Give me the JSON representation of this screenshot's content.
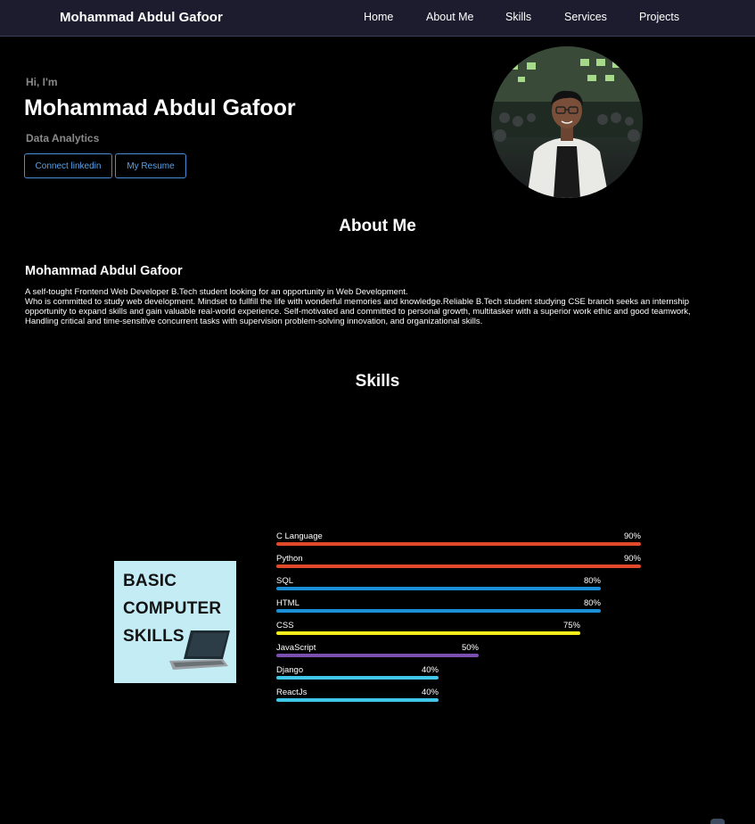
{
  "navbar": {
    "brand": "Mohammad Abdul Gafoor",
    "links": [
      "Home",
      "About Me",
      "Skills",
      "Services",
      "Projects"
    ]
  },
  "hero": {
    "greeting": "Hi, I'm",
    "name": "Mohammad Abdul Gafoor",
    "role": "Data Analytics",
    "buttons": {
      "linkedin": "Connect linkedin",
      "resume": "My Resume"
    }
  },
  "about": {
    "title": "About Me",
    "name": "Mohammad Abdul Gafoor",
    "line1": "A self-tought Frontend Web Developer B.Tech student looking for an opportunity in Web Development.",
    "line2": "Who is committed to study web development. Mindset to fullfill the life with wonderful memories and knowledge.Reliable B.Tech student studying CSE branch seeks an internship opportunity to expand skills and gain valuable real-world experience. Self-motivated and committed to personal growth, multitasker with a superior work ethic and good teamwork, Handling critical and time-sensitive concurrent tasks with supervision problem-solving innovation, and organizational skills."
  },
  "skills": {
    "title": "Skills",
    "image_text": [
      "BASIC",
      "COMPUTER",
      "SKILLS"
    ],
    "items": [
      {
        "name": "C Language",
        "percent": 90,
        "label": "90%",
        "color": "#e04a2a"
      },
      {
        "name": "Python",
        "percent": 90,
        "label": "90%",
        "color": "#e04a2a"
      },
      {
        "name": "SQL",
        "percent": 80,
        "label": "80%",
        "color": "#1a8fd6"
      },
      {
        "name": "HTML",
        "percent": 80,
        "label": "80%",
        "color": "#1a8fd6"
      },
      {
        "name": "CSS",
        "percent": 75,
        "label": "75%",
        "color": "#f5ee1a"
      },
      {
        "name": "JavaScript",
        "percent": 50,
        "label": "50%",
        "color": "#7a4fb0"
      },
      {
        "name": "Django",
        "percent": 40,
        "label": "40%",
        "color": "#3fc6e8"
      },
      {
        "name": "ReactJs",
        "percent": 40,
        "label": "40%",
        "color": "#3fc6e8"
      }
    ]
  },
  "colors": {
    "navbar_bg": "#1c1c2e",
    "button_accent": "#4a8cd6",
    "muted_text": "#8a8a8a"
  }
}
